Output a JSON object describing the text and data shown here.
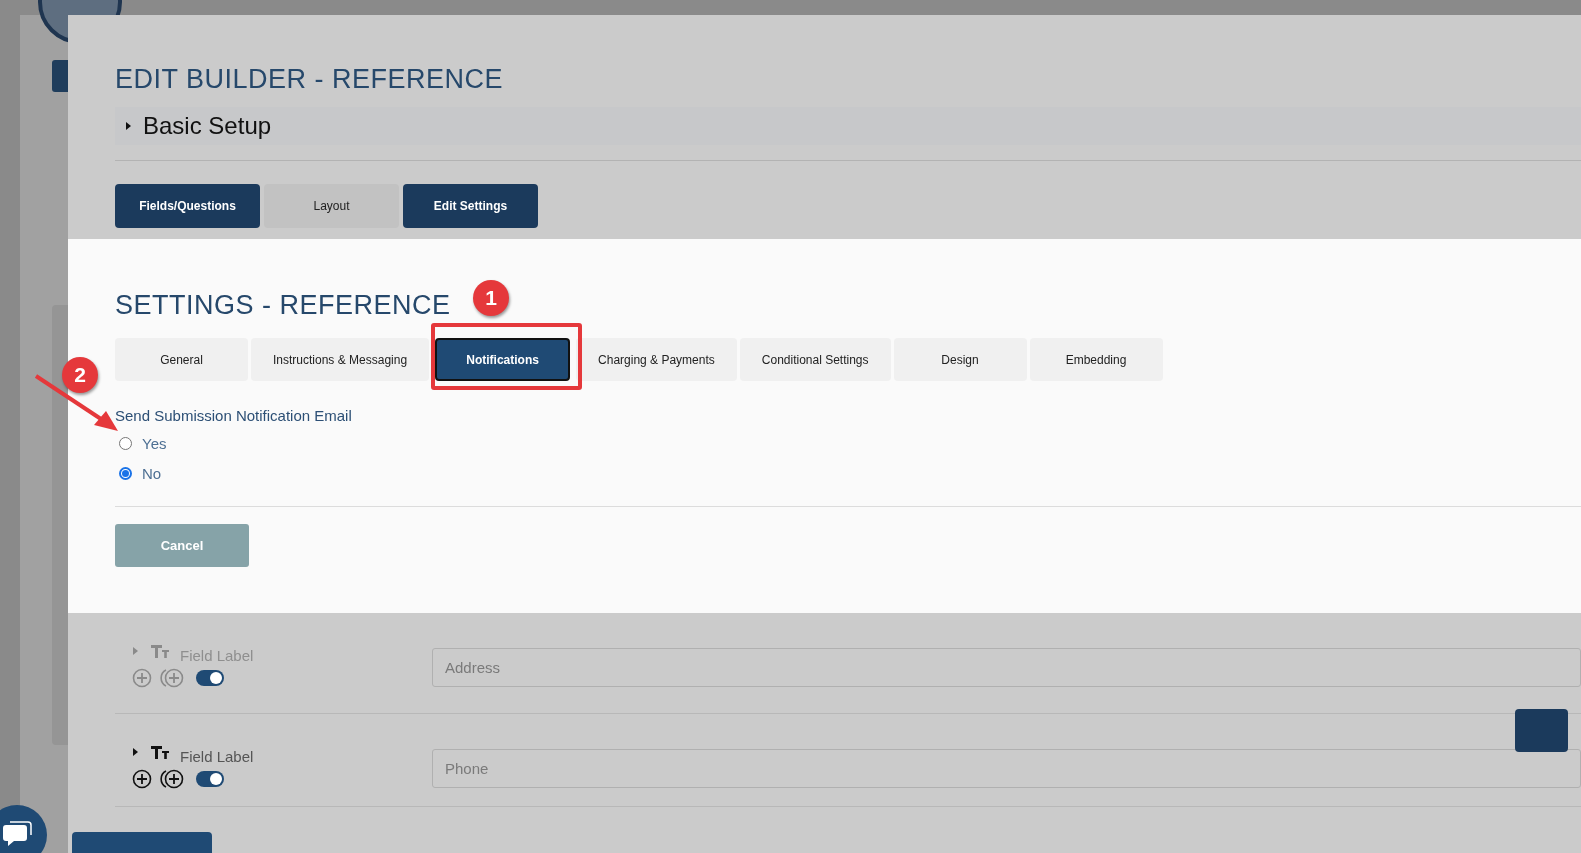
{
  "header": {
    "title": "EDIT BUILDER - REFERENCE",
    "section": {
      "label": "Basic Setup",
      "expanded": false
    }
  },
  "builder_tabs": [
    {
      "label": "Fields/Questions",
      "selected": true
    },
    {
      "label": "Layout",
      "selected": false
    },
    {
      "label": "Edit Settings",
      "selected": true
    }
  ],
  "settings": {
    "title": "SETTINGS - REFERENCE",
    "tabs": [
      {
        "label": "General",
        "selected": false
      },
      {
        "label": "Instructions & Messaging",
        "selected": false
      },
      {
        "label": "Notifications",
        "selected": true
      },
      {
        "label": "Charging & Payments",
        "selected": false
      },
      {
        "label": "Conditional Settings",
        "selected": false
      },
      {
        "label": "Design",
        "selected": false
      },
      {
        "label": "Embedding",
        "selected": false
      }
    ],
    "question": "Send Submission Notification Email",
    "options": [
      {
        "label": "Yes",
        "selected": false
      },
      {
        "label": "No",
        "selected": true
      }
    ],
    "cancel_button": "Cancel"
  },
  "fields": [
    {
      "label": "Field Label",
      "placeholder": "Address",
      "faded": true,
      "on": true
    },
    {
      "label": "Field Label",
      "placeholder": "Phone",
      "faded": false,
      "on": true
    }
  ],
  "annotations": [
    {
      "number": "1"
    },
    {
      "number": "2"
    }
  ]
}
